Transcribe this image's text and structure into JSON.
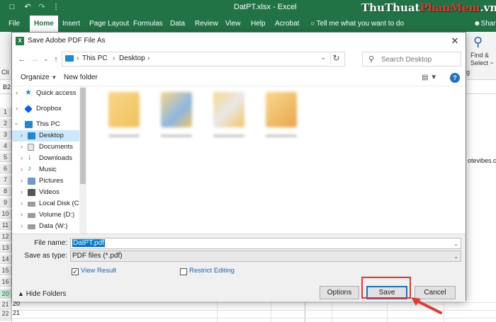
{
  "excel": {
    "file_name": "DatPT.xlsx - Excel",
    "tabs": [
      "File",
      "Home",
      "Insert",
      "Page Layout",
      "Formulas",
      "Data",
      "Review",
      "View",
      "Help",
      "Acrobat"
    ],
    "active_tab": "Home",
    "tell_me": "Tell me what you want to do",
    "share": "Share",
    "find_select": "Find &",
    "find_select_2": "Select ~",
    "ribbon_editing": "g",
    "clipboard_snip": "Cli",
    "name_box": "B2",
    "cell_text": "otevibes.c",
    "row_numbers": [
      "1",
      "2",
      "3",
      "4",
      "5",
      "6",
      "7",
      "8",
      "9",
      "10",
      "11",
      "12",
      "13",
      "14",
      "15",
      "16",
      "17",
      "18",
      "19",
      "20",
      "21",
      "22"
    ],
    "selected_row": "20",
    "extra_row_labels": [
      "20",
      "21"
    ]
  },
  "watermark": {
    "part1": "ThuThuat",
    "part2": "PhanMem",
    "part3": ".vn"
  },
  "dialog": {
    "title": "Save Adobe PDF File As",
    "breadcrumb": [
      "This PC",
      "Desktop"
    ],
    "search_placeholder": "Search Desktop",
    "toolbar": {
      "organize": "Organize",
      "new_folder": "New folder"
    },
    "nav_items": [
      {
        "label": "Quick access",
        "icon": "star-icon",
        "color": "#1e88d6"
      },
      {
        "label": "Dropbox",
        "icon": "dropbox-icon",
        "color": "#0061fe"
      },
      {
        "label": "This PC",
        "icon": "computer-icon",
        "color": "#1e88d6"
      },
      {
        "label": "Desktop",
        "icon": "desktop-folder-icon",
        "color": "#1e88d6"
      },
      {
        "label": "Documents",
        "icon": "documents-icon",
        "color": "#8a8a8a"
      },
      {
        "label": "Downloads",
        "icon": "downloads-icon",
        "color": "#1e72c4"
      },
      {
        "label": "Music",
        "icon": "music-icon",
        "color": "#1e72c4"
      },
      {
        "label": "Pictures",
        "icon": "pictures-icon",
        "color": "#6a9ccf"
      },
      {
        "label": "Videos",
        "icon": "videos-icon",
        "color": "#555555"
      },
      {
        "label": "Local Disk (C:)",
        "icon": "disk-icon",
        "color": "#7a7a7a"
      },
      {
        "label": "Volume (D:)",
        "icon": "disk-icon",
        "color": "#7a7a7a"
      },
      {
        "label": "Data (W:)",
        "icon": "disk-icon",
        "color": "#7a7a7a"
      }
    ],
    "selected_nav": "Desktop",
    "file_name_label": "File name:",
    "file_name_value": "DatPT.pdf",
    "save_type_label": "Save as type:",
    "save_type_value": "PDF files (*.pdf)",
    "view_result": {
      "label": "View Result",
      "checked": true
    },
    "restrict_editing": {
      "label": "Restrict Editing",
      "checked": false
    },
    "hide_folders": "Hide Folders",
    "buttons": {
      "options": "Options",
      "save": "Save",
      "cancel": "Cancel"
    }
  },
  "colors": {
    "excel_green": "#217346",
    "accent": "#0078d7",
    "highlight": "#e53935"
  }
}
